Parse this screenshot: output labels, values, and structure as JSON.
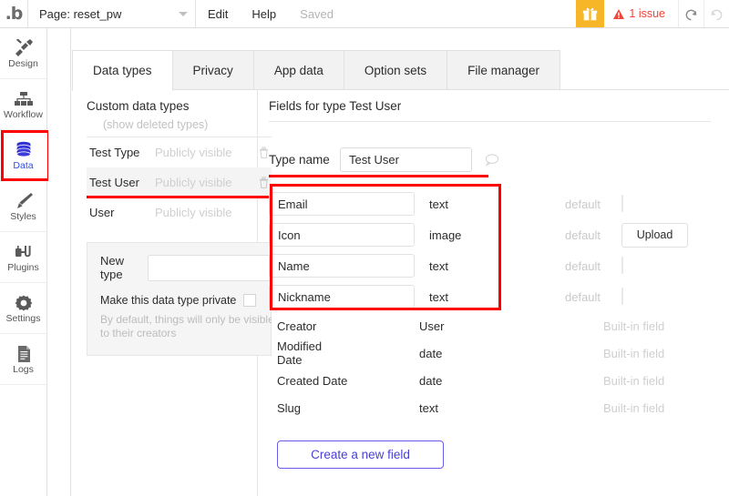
{
  "topbar": {
    "logo": "logo-bubble",
    "page_label": "Page: reset_pw",
    "menu": [
      {
        "label": "Edit",
        "muted": false
      },
      {
        "label": "Help",
        "muted": false
      },
      {
        "label": "Saved",
        "muted": true
      }
    ],
    "gift_icon": "gift-icon",
    "issue_text": "1 issue",
    "warning_icon": "warning-triangle-icon",
    "undo_icon": "undo-icon",
    "redo_icon": "redo-icon",
    "accent_orange": "#f7b528",
    "issue_red": "#f0453a"
  },
  "sidebar": {
    "items": [
      {
        "label": "Design",
        "icon": "design-icon",
        "active": false
      },
      {
        "label": "Workflow",
        "icon": "workflow-icon",
        "active": false
      },
      {
        "label": "Data",
        "icon": "database-icon",
        "active": true
      },
      {
        "label": "Styles",
        "icon": "brush-icon",
        "active": false
      },
      {
        "label": "Plugins",
        "icon": "plugins-icon",
        "active": false
      },
      {
        "label": "Settings",
        "icon": "gear-icon",
        "active": false
      },
      {
        "label": "Logs",
        "icon": "document-icon",
        "active": false
      }
    ],
    "active_color": "#2f4de0"
  },
  "tabs": [
    {
      "label": "Data types",
      "active": true
    },
    {
      "label": "Privacy",
      "active": false
    },
    {
      "label": "App data",
      "active": false
    },
    {
      "label": "Option sets",
      "active": false
    },
    {
      "label": "File manager",
      "active": false
    }
  ],
  "left_panel": {
    "title": "Custom data types",
    "show_deleted": "(show deleted types)",
    "data_types": [
      {
        "name": "Test Type",
        "visibility": "Publicly visible",
        "has_trash": true,
        "selected": false,
        "annotated": false
      },
      {
        "name": "Test User",
        "visibility": "Publicly visible",
        "has_trash": true,
        "selected": true,
        "annotated": true
      },
      {
        "name": "User",
        "visibility": "Publicly visible",
        "has_trash": false,
        "selected": false,
        "annotated": false
      }
    ],
    "new_type": {
      "label": "New type",
      "input_value": "",
      "private_label": "Make this data type private",
      "help_text": "By default, things will only be visible to their creators"
    }
  },
  "right_panel": {
    "title": "Fields for type Test User",
    "type_name_label": "Type name",
    "type_name_value": "Test User",
    "comment_icon": "speech-bubble-icon",
    "custom_fields": [
      {
        "name": "Email",
        "type": "text",
        "default_label": "default",
        "control": "input"
      },
      {
        "name": "Icon",
        "type": "image",
        "default_label": "default",
        "control": "upload",
        "control_label": "Upload"
      },
      {
        "name": "Name",
        "type": "text",
        "default_label": "default",
        "control": "input"
      },
      {
        "name": "Nickname",
        "type": "text",
        "default_label": "default",
        "control": "input"
      }
    ],
    "builtin_fields": [
      {
        "name": "Creator",
        "type": "User",
        "note": "Built-in field"
      },
      {
        "name": "Modified Date",
        "type": "date",
        "note": "Built-in field"
      },
      {
        "name": "Created Date",
        "type": "date",
        "note": "Built-in field"
      },
      {
        "name": "Slug",
        "type": "text",
        "note": "Built-in field"
      }
    ],
    "create_button": "Create a new field",
    "create_button_color": "#4a3fd6"
  },
  "annotations": {
    "color": "#ff0000",
    "marks": [
      "data-sidebar-highlight-box",
      "data-types-tab-underline",
      "test-user-row-underline",
      "type-name-underline",
      "custom-fields-box"
    ]
  }
}
